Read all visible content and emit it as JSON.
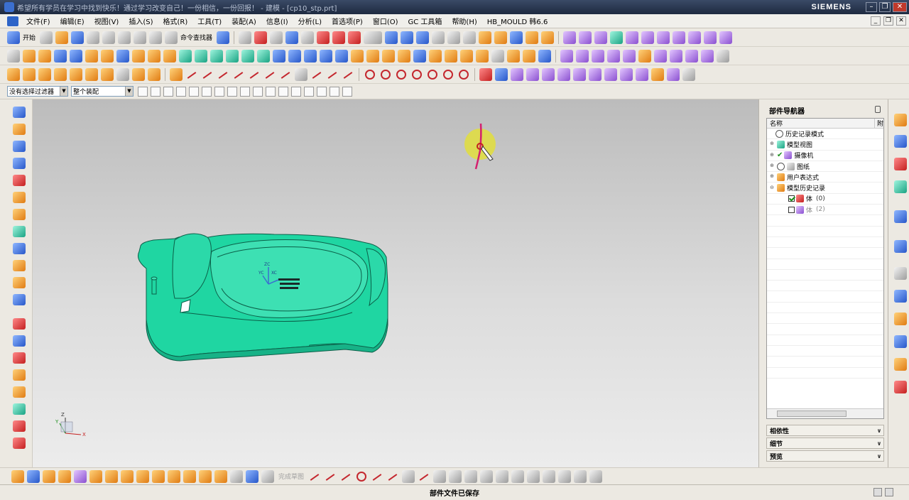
{
  "window": {
    "title": "希望所有学员在学习中找到快乐！通过学习改变自己！一份相信，一份回报！ - 建模 - [cp10_stp.prt]",
    "brand": "SIEMENS"
  },
  "menu": [
    "文件(F)",
    "编辑(E)",
    "视图(V)",
    "插入(S)",
    "格式(R)",
    "工具(T)",
    "装配(A)",
    "信息(I)",
    "分析(L)",
    "首选项(P)",
    "窗口(O)",
    "GC 工具箱",
    "帮助(H)",
    "HB_MOULD 韩6.6"
  ],
  "toolbar": {
    "start_label": "开始",
    "command_finder_label": "命令查找器"
  },
  "filterbar": {
    "selection_filter": "没有选择过滤器",
    "assembly_scope": "整个装配"
  },
  "part_navigator": {
    "title": "部件导航器",
    "col_name": "名称",
    "col_attached": "附",
    "items": [
      {
        "label": "历史记录模式",
        "icon": "history-icon"
      },
      {
        "label": "模型视图",
        "icon": "model-views-icon"
      },
      {
        "label": "摄像机",
        "icon": "camera-icon"
      },
      {
        "label": "图纸",
        "icon": "drawing-icon"
      },
      {
        "label": "用户表达式",
        "icon": "folder-icon"
      },
      {
        "label": "模型历史记录",
        "icon": "folder-open-icon"
      },
      {
        "label": "体",
        "suffix": "(0)",
        "checked": true
      },
      {
        "label": "体",
        "suffix": "(2)",
        "checked": false
      }
    ]
  },
  "sections": {
    "dependencies": "相依性",
    "details": "细节",
    "preview": "预览"
  },
  "bottom": {
    "finish_sketch_label": "完成草图"
  },
  "status": {
    "message": "部件文件已保存"
  },
  "viewport": {
    "part_color": "#1fd6a2",
    "axis_labels": [
      "ZC",
      "XC",
      "YC"
    ],
    "triad_labels": [
      "Z",
      "X",
      "Y"
    ]
  }
}
